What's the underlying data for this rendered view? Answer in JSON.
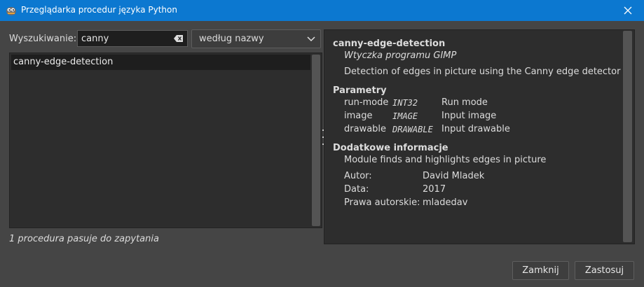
{
  "window": {
    "title": "Przeglądarka procedur języka Python",
    "accent_color": "#0c78d0"
  },
  "search": {
    "label": "Wyszukiwanie:",
    "value": "canny",
    "mode": "według nazwy"
  },
  "results": {
    "items": [
      {
        "label": "canny-edge-detection"
      }
    ],
    "status": "1 procedura pasuje do zapytania"
  },
  "procedure": {
    "name": "canny-edge-detection",
    "source": "Wtyczka programu GIMP",
    "description": "Detection of edges in picture using the Canny edge detector",
    "params_heading": "Parametry",
    "params": [
      {
        "name": "run-mode",
        "type": "INT32",
        "desc": "Run mode"
      },
      {
        "name": "image",
        "type": "IMAGE",
        "desc": "Input image"
      },
      {
        "name": "drawable",
        "type": "DRAWABLE",
        "desc": "Input drawable"
      }
    ],
    "extra_heading": "Dodatkowe informacje",
    "extra_text": "Module finds and highlights edges in picture",
    "meta": [
      {
        "label": "Autor:",
        "value": "David Mladek"
      },
      {
        "label": "Data:",
        "value": "2017"
      },
      {
        "label": "Prawa autorskie:",
        "value": "mladedav"
      }
    ]
  },
  "buttons": {
    "close": "Zamknij",
    "apply": "Zastosuj"
  }
}
